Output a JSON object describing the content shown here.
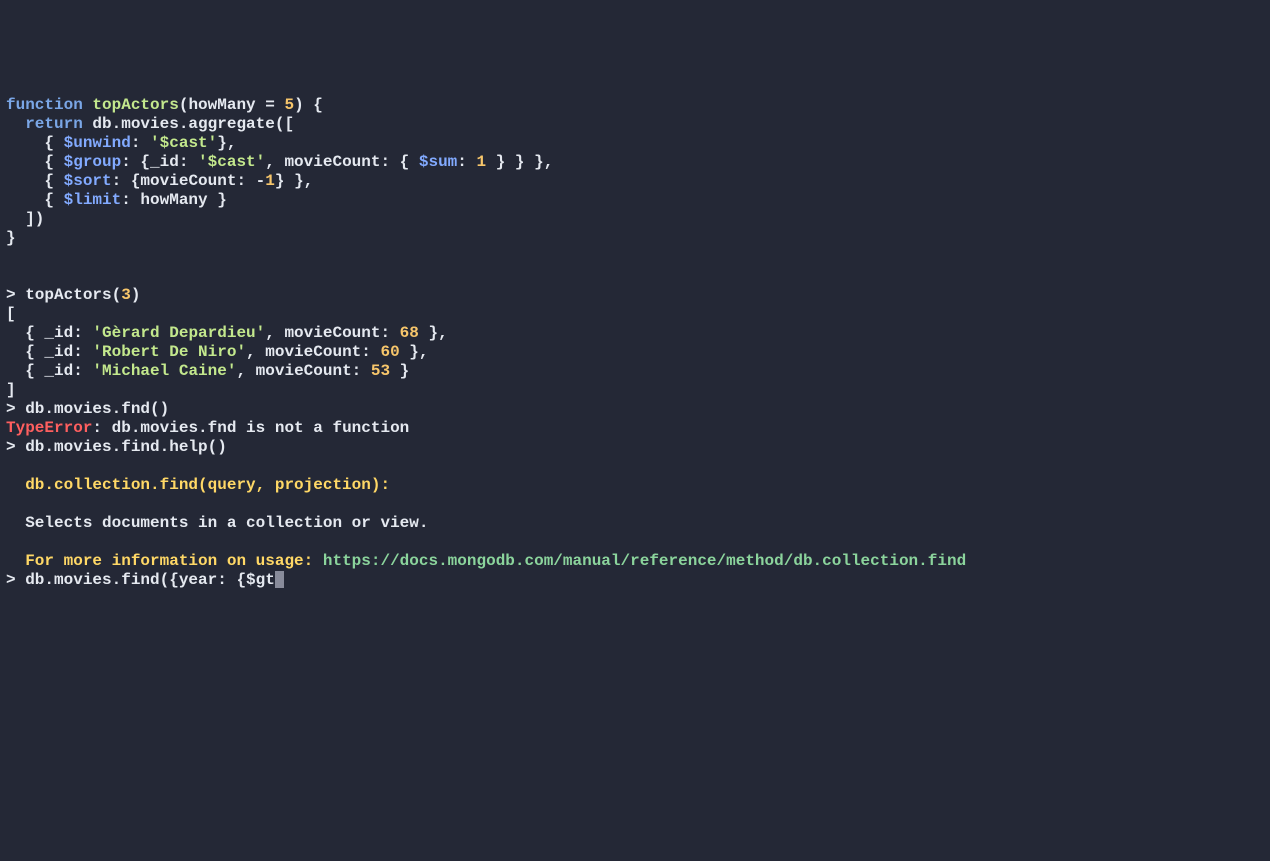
{
  "fn_def": {
    "keyword_function": "function",
    "name": "topActors",
    "param_open": "(howMany = ",
    "param_default": "5",
    "param_close": ") {",
    "return_kw": "return",
    "return_rest": " db.movies.aggregate([",
    "stage_unwind_pre": "    { ",
    "stage_unwind_op": "$unwind",
    "stage_unwind_mid": ": ",
    "stage_unwind_str": "'$cast'",
    "stage_unwind_post": "},",
    "stage_group_pre": "    { ",
    "stage_group_op": "$group",
    "stage_group_mid": ": {_id: ",
    "stage_group_str": "'$cast'",
    "stage_group_mid2": ", movieCount: { ",
    "stage_group_sum": "$sum",
    "stage_group_mid3": ": ",
    "stage_group_num": "1",
    "stage_group_post": " } } },",
    "stage_sort_pre": "    { ",
    "stage_sort_op": "$sort",
    "stage_sort_mid": ": {movieCount: -",
    "stage_sort_num": "1",
    "stage_sort_post": "} },",
    "stage_limit_pre": "    { ",
    "stage_limit_op": "$limit",
    "stage_limit_post": ": howMany }",
    "close_arr": "  ])",
    "close_fn": "}"
  },
  "call1": {
    "prompt": "> ",
    "text_pre": "topActors(",
    "arg": "3",
    "text_post": ")"
  },
  "results": {
    "open": "[",
    "rows": [
      {
        "pre": "  { _id: ",
        "name": "'Gèrard Depardieu'",
        "mid": ", movieCount: ",
        "count": "68",
        "post": " },"
      },
      {
        "pre": "  { _id: ",
        "name": "'Robert De Niro'",
        "mid": ", movieCount: ",
        "count": "60",
        "post": " },"
      },
      {
        "pre": "  { _id: ",
        "name": "'Michael Caine'",
        "mid": ", movieCount: ",
        "count": "53",
        "post": " }"
      }
    ],
    "close": "]"
  },
  "call2": {
    "prompt": "> ",
    "text": "db.movies.fnd()"
  },
  "error": {
    "label": "TypeError",
    "rest": ": db.movies.fnd is not a function"
  },
  "call3": {
    "prompt": "> ",
    "text": "db.movies.find.help()"
  },
  "help": {
    "heading": "  db.collection.find(query, projection):",
    "desc": "  Selects documents in a collection or view.",
    "info_pre": "  For more information on usage: ",
    "url": "https://docs.mongodb.com/manual/reference/method/db.collection.find"
  },
  "input": {
    "prompt": "> ",
    "text": "db.movies.find({year: {$gt"
  }
}
